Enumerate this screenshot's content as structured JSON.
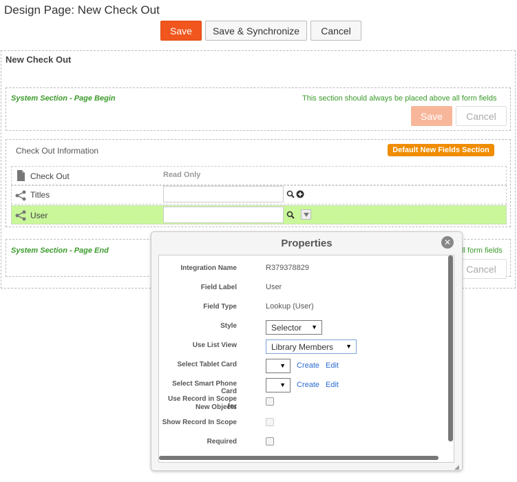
{
  "header": {
    "title": "Design Page: New Check Out",
    "save_label": "Save",
    "save_sync_label": "Save & Synchronize",
    "cancel_label": "Cancel"
  },
  "form": {
    "title": "New Check Out",
    "system_begin": {
      "title": "System Section - Page Begin",
      "note": "This section should always be placed above all form fields",
      "save_label": "Save",
      "cancel_label": "Cancel"
    },
    "section": {
      "title": "Check Out Information",
      "badge": "Default New Fields Section",
      "rows": [
        {
          "label": "Check Out",
          "value": "Read Only"
        },
        {
          "label": "Titles"
        },
        {
          "label": "User"
        }
      ]
    },
    "system_end": {
      "title": "System Section - Page End",
      "note": "all form fields",
      "cancel_label": "Cancel"
    }
  },
  "properties": {
    "title": "Properties",
    "integration_name_label": "Integration Name",
    "integration_name_value": "R379378829",
    "field_label_label": "Field Label",
    "field_label_value": "User",
    "field_type_label": "Field Type",
    "field_type_value": "Lookup (User)",
    "style_label": "Style",
    "style_value": "Selector",
    "list_view_label": "Use List View",
    "list_view_value": "Library Members",
    "tablet_card_label": "Select Tablet Card",
    "phone_card_label": "Select Smart Phone Card",
    "create_label": "Create",
    "edit_label": "Edit",
    "record_scope_label_1": "Use Record in Scope for",
    "record_scope_label_2": "New Objects",
    "show_record_label": "Show Record In Scope",
    "required_label": "Required"
  }
}
